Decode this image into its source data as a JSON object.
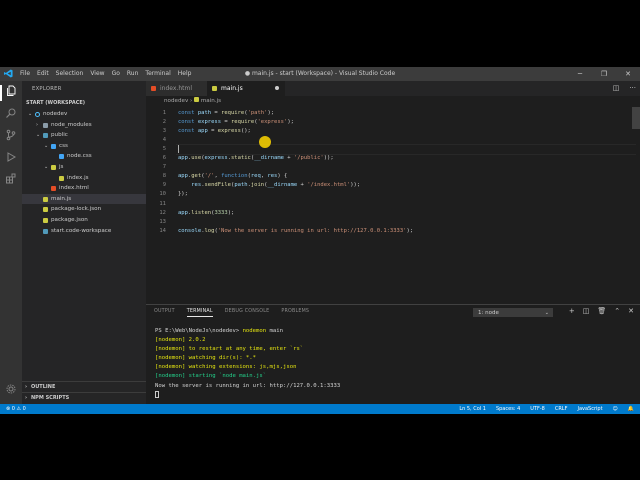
{
  "titlebar": {
    "menu": [
      "File",
      "Edit",
      "Selection",
      "View",
      "Go",
      "Run",
      "Terminal",
      "Help"
    ],
    "title": "● main.js - start (Workspace) - Visual Studio Code",
    "controls": [
      "─",
      "❐",
      "✕"
    ]
  },
  "activity": [
    "files-icon",
    "search-icon",
    "source-control-icon",
    "run-debug-icon",
    "extensions-icon"
  ],
  "sidebar": {
    "title": "EXPLORER",
    "workspace": "START (WORKSPACE)",
    "tree": [
      {
        "label": "nodedev",
        "depth": 0,
        "twisty": "⌄",
        "icon": "#4fc1ff",
        "kind": "root"
      },
      {
        "label": "node_modules",
        "depth": 1,
        "twisty": "›",
        "icon": "#8a9ba8",
        "kind": "folder"
      },
      {
        "label": "public",
        "depth": 1,
        "twisty": "⌄",
        "icon": "#519aba",
        "kind": "folder"
      },
      {
        "label": "css",
        "depth": 2,
        "twisty": "⌄",
        "icon": "#42a5f5",
        "kind": "folder"
      },
      {
        "label": "node.css",
        "depth": 3,
        "twisty": "",
        "icon": "#42a5f5",
        "kind": "file"
      },
      {
        "label": "js",
        "depth": 2,
        "twisty": "⌄",
        "icon": "#cbcb41",
        "kind": "folder"
      },
      {
        "label": "index.js",
        "depth": 3,
        "twisty": "",
        "icon": "#cbcb41",
        "kind": "file"
      },
      {
        "label": "index.html",
        "depth": 2,
        "twisty": "",
        "icon": "#e44d26",
        "kind": "file"
      },
      {
        "label": "main.js",
        "depth": 1,
        "twisty": "",
        "icon": "#cbcb41",
        "kind": "file",
        "selected": true
      },
      {
        "label": "package-lock.json",
        "depth": 1,
        "twisty": "",
        "icon": "#cbcb41",
        "kind": "file"
      },
      {
        "label": "package.json",
        "depth": 1,
        "twisty": "",
        "icon": "#cbcb41",
        "kind": "file"
      },
      {
        "label": "start.code-workspace",
        "depth": 1,
        "twisty": "",
        "icon": "#519aba",
        "kind": "file"
      }
    ],
    "outline": "OUTLINE",
    "npm": "NPM SCRIPTS"
  },
  "tabs": [
    {
      "label": "index.html",
      "icon": "#e44d26"
    },
    {
      "label": "main.js",
      "icon": "#cbcb41"
    }
  ],
  "breadcrumb": {
    "folder": "nodedev",
    "file": "main.js"
  },
  "code": [
    [
      [
        "const ",
        "k"
      ],
      [
        "path",
        "v"
      ],
      [
        " = ",
        "p"
      ],
      [
        "require",
        "f"
      ],
      [
        "(",
        "p"
      ],
      [
        "'path'",
        "s"
      ],
      [
        ");",
        "p"
      ]
    ],
    [
      [
        "const ",
        "k"
      ],
      [
        "express",
        "v"
      ],
      [
        " = ",
        "p"
      ],
      [
        "require",
        "f"
      ],
      [
        "(",
        "p"
      ],
      [
        "'express'",
        "s"
      ],
      [
        ");",
        "p"
      ]
    ],
    [
      [
        "const ",
        "k"
      ],
      [
        "app",
        "v"
      ],
      [
        " = ",
        "p"
      ],
      [
        "express",
        "f"
      ],
      [
        "();",
        "p"
      ]
    ],
    [],
    [],
    [
      [
        "app",
        "v"
      ],
      [
        ".",
        "p"
      ],
      [
        "use",
        "f"
      ],
      [
        "(",
        "p"
      ],
      [
        "express",
        "v"
      ],
      [
        ".",
        "p"
      ],
      [
        "static",
        "f"
      ],
      [
        "(",
        "p"
      ],
      [
        "__dirname",
        "v"
      ],
      [
        " + ",
        "p"
      ],
      [
        "'/public'",
        "s"
      ],
      [
        "));",
        "p"
      ]
    ],
    [],
    [
      [
        "app",
        "v"
      ],
      [
        ".",
        "p"
      ],
      [
        "get",
        "f"
      ],
      [
        "(",
        "p"
      ],
      [
        "'/'",
        "s"
      ],
      [
        ", ",
        "p"
      ],
      [
        "function",
        "k"
      ],
      [
        "(",
        "p"
      ],
      [
        "req",
        "v"
      ],
      [
        ", ",
        "p"
      ],
      [
        "res",
        "v"
      ],
      [
        ") {",
        "p"
      ]
    ],
    [
      [
        "    res",
        "v"
      ],
      [
        ".",
        "p"
      ],
      [
        "sendFile",
        "f"
      ],
      [
        "(",
        "p"
      ],
      [
        "path",
        "v"
      ],
      [
        ".",
        "p"
      ],
      [
        "join",
        "f"
      ],
      [
        "(",
        "p"
      ],
      [
        "__dirname",
        "v"
      ],
      [
        " + ",
        "p"
      ],
      [
        "'/index.html'",
        "s"
      ],
      [
        "));",
        "p"
      ]
    ],
    [
      [
        "});",
        "p"
      ]
    ],
    [],
    [
      [
        "app",
        "v"
      ],
      [
        ".",
        "p"
      ],
      [
        "listen",
        "f"
      ],
      [
        "(",
        "p"
      ],
      [
        "3333",
        "n"
      ],
      [
        ");",
        "p"
      ]
    ],
    [],
    [
      [
        "console",
        "v"
      ],
      [
        ".",
        "p"
      ],
      [
        "log",
        "f"
      ],
      [
        "(",
        "p"
      ],
      [
        "'Now the server is running in url: http://127.0.0.1:3333'",
        "s"
      ],
      [
        ");",
        "p"
      ]
    ]
  ],
  "panel": {
    "tabs": [
      "OUTPUT",
      "TERMINAL",
      "DEBUG CONSOLE",
      "PROBLEMS"
    ],
    "active_tab": "TERMINAL",
    "terminal_select": "1: node",
    "tools": [
      "+",
      "◫",
      "🗑",
      "⌃",
      "✕"
    ],
    "lines": [
      [
        [
          "PS E:\\Web\\NodeJs\\nodedev> ",
          "p"
        ],
        [
          "nodemon ",
          "yl"
        ],
        [
          "main",
          "p"
        ]
      ],
      [
        [
          "[nodemon] 2.0.2",
          "yl"
        ]
      ],
      [
        [
          "[nodemon] to restart at any time, enter `rs`",
          "yl"
        ]
      ],
      [
        [
          "[nodemon] watching dir(s): *.*",
          "yl"
        ]
      ],
      [
        [
          "[nodemon] watching extensions: js,mjs,json",
          "yl"
        ]
      ],
      [
        [
          "[nodemon] starting `node main.js`",
          "gn"
        ]
      ],
      [
        [
          "Now the server is running in url: http://127.0.0.1:3333",
          "p"
        ]
      ]
    ]
  },
  "status": {
    "left": "⊗ 0  ⚠ 0",
    "right": [
      "Ln 5, Col 1",
      "Spaces: 4",
      "UTF-8",
      "CRLF",
      "JavaScript",
      "☺",
      "🔔"
    ]
  },
  "colors": {
    "accent": "#007acc",
    "titlebar": "#3c3c3c",
    "sidebar": "#252526",
    "editor": "#1e1e1e"
  }
}
